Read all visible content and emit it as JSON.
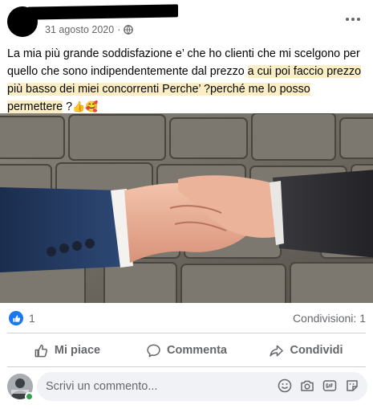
{
  "post": {
    "date": "31 agosto 2020",
    "separator": "·",
    "privacy_icon": "globe-icon",
    "options_icon": "more-options-icon",
    "text_plain": "La mia più grande soddisfazione e’ che ho clienti che mi scelgono per quello che sono indipendentemente dal prezzo ",
    "text_highlight": "a cui poi faccio prezzo più basso dei miei concorrenti Perche’ ?perché me lo posso permettere",
    "text_tail": " ?",
    "emojis": "👍🥰"
  },
  "stats": {
    "reaction_icon": "like-reaction-icon",
    "like_count": "1",
    "shares": "Condivisioni: 1"
  },
  "actions": {
    "like_label": "Mi piace",
    "comment_label": "Commenta",
    "share_label": "Condividi"
  },
  "comment": {
    "placeholder": "Scrivi un commento...",
    "icons": [
      "emoji-icon",
      "camera-icon",
      "gif-icon",
      "sticker-icon"
    ]
  },
  "colors": {
    "accent": "#1877f2",
    "muted_text": "#65676b",
    "highlight": "#fbeec4",
    "online": "#31a24c"
  }
}
